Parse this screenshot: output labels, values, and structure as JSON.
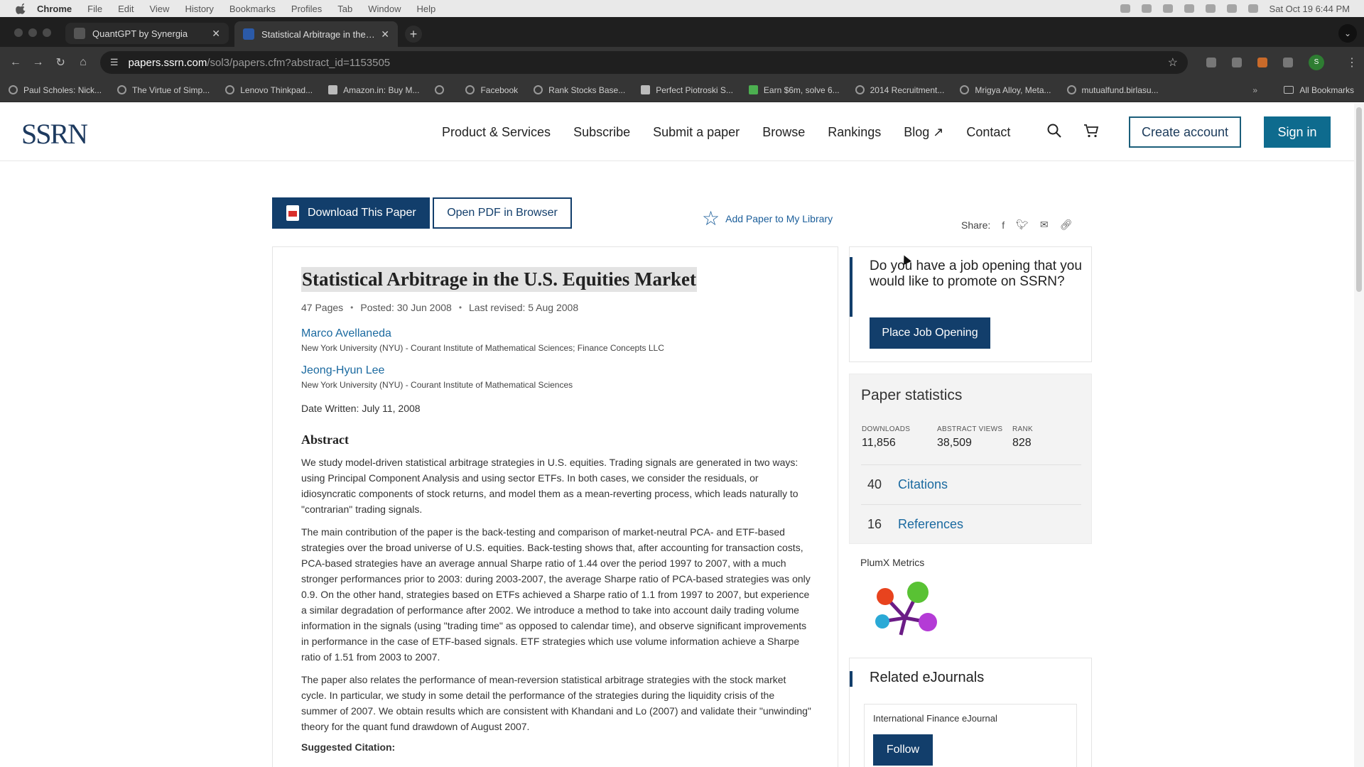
{
  "macos": {
    "app": "Chrome",
    "menus": [
      "File",
      "Edit",
      "View",
      "History",
      "Bookmarks",
      "Profiles",
      "Tab",
      "Window",
      "Help"
    ],
    "clock": "Sat Oct 19  6:44 PM"
  },
  "browser": {
    "tabs": [
      {
        "title": "QuantGPT by Synergia",
        "active": false
      },
      {
        "title": "Statistical Arbitrage in the U.S.",
        "active": true
      }
    ],
    "new_tab": "+",
    "url_host": "papers.ssrn.com",
    "url_path": "/sol3/papers.cfm?abstract_id=1153505",
    "profile_initial": "S",
    "bookmarks": [
      "Paul Scholes: Nick...",
      "The Virtue of Simp...",
      "Lenovo Thinkpad...",
      "Amazon.in: Buy M...",
      "",
      "Facebook",
      "Rank Stocks Base...",
      "Perfect Piotroski S...",
      "Earn $6m, solve 6...",
      "2014 Recruitment...",
      "Mrigya Alloy, Meta...",
      "mutualfund.birlasu..."
    ],
    "bookmarks_more": "»",
    "all_bookmarks": "All Bookmarks"
  },
  "site": {
    "logo": "SSRN",
    "nav": [
      "Product & Services",
      "Subscribe",
      "Submit a paper",
      "Browse",
      "Rankings",
      "Blog ↗",
      "Contact"
    ],
    "create_account": "Create account",
    "sign_in": "Sign in"
  },
  "actions": {
    "download": "Download This Paper",
    "open_pdf": "Open PDF in Browser",
    "add_library": "Add Paper to My Library",
    "share_label": "Share:"
  },
  "paper": {
    "title": "Statistical Arbitrage in the U.S. Equities Market",
    "pages": "47 Pages",
    "posted": "Posted: 30 Jun 2008",
    "revised": "Last revised: 5 Aug 2008",
    "authors": [
      {
        "name": "Marco Avellaneda",
        "affiliation": "New York University (NYU) - Courant Institute of Mathematical Sciences; Finance Concepts LLC"
      },
      {
        "name": "Jeong-Hyun Lee",
        "affiliation": "New York University (NYU) - Courant Institute of Mathematical Sciences"
      }
    ],
    "date_written": "Date Written: July 11, 2008",
    "abstract_heading": "Abstract",
    "abstract": [
      "We study model-driven statistical arbitrage strategies in U.S. equities. Trading signals are generated in two ways: using Principal Component Analysis and using sector ETFs. In both cases, we consider the residuals, or idiosyncratic components of stock returns, and model them as a mean-reverting process, which leads naturally to \"contrarian\" trading signals.",
      "The main contribution of the paper is the back-testing and comparison of market-neutral PCA- and ETF-based strategies over the broad universe of U.S. equities. Back-testing shows that, after accounting for transaction costs, PCA-based strategies have an average annual Sharpe ratio of 1.44 over the period 1997 to 2007, with a much stronger performances prior to 2003: during 2003-2007, the average Sharpe ratio of PCA-based strategies was only 0.9. On the other hand, strategies based on ETFs achieved a Sharpe ratio of 1.1 from 1997 to 2007, but experience a similar degradation of performance after 2002. We introduce a method to take into account daily trading volume information in the signals (using \"trading time\" as opposed to calendar time), and observe significant improvements in performance in the case of ETF-based signals. ETF strategies which use volume information achieve a Sharpe ratio of 1.51 from 2003 to 2007.",
      "The paper also relates the performance of mean-reversion statistical arbitrage strategies with the stock market cycle. In particular, we study in some detail the performance of the strategies during the liquidity crisis of the summer of 2007. We obtain results which are consistent with Khandani and Lo (2007) and validate their \"unwinding\" theory for the quant fund drawdown of August 2007."
    ],
    "suggested_citation": "Suggested Citation:"
  },
  "job": {
    "question": "Do you have a job opening that you would like to promote on SSRN?",
    "button": "Place Job Opening"
  },
  "stats": {
    "heading": "Paper statistics",
    "downloads_label": "DOWNLOADS",
    "downloads": "11,856",
    "views_label": "ABSTRACT VIEWS",
    "views": "38,509",
    "rank_label": "RANK",
    "rank": "828",
    "citations_count": "40",
    "citations_label": "Citations",
    "references_count": "16",
    "references_label": "References"
  },
  "plumx": {
    "label": "PlumX Metrics",
    "colors": [
      "#e8431e",
      "#59c234",
      "#2aa9d6",
      "#b43bd6",
      "#6b1c86"
    ]
  },
  "ejournals": {
    "heading": "Related eJournals",
    "journal": "International Finance eJournal",
    "follow": "Follow"
  }
}
